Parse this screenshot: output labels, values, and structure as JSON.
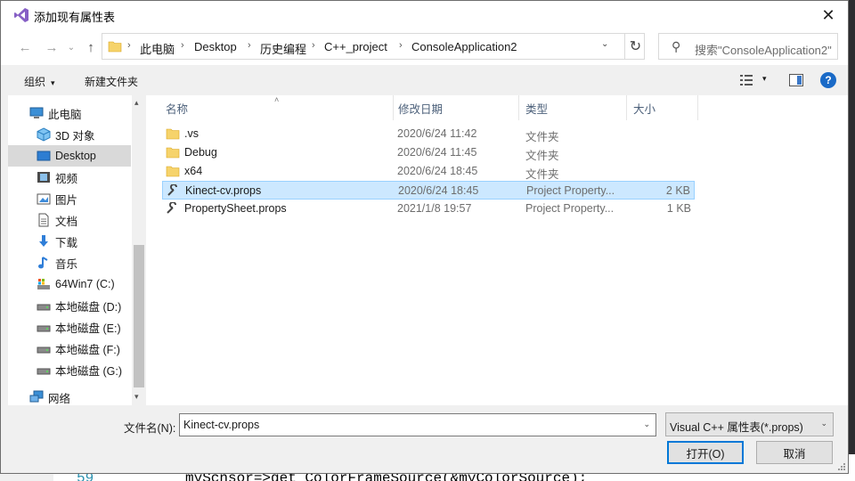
{
  "dialog": {
    "title": "添加现有属性表",
    "close_glyph": "✕"
  },
  "nav": {
    "back_glyph": "←",
    "forward_glyph": "→",
    "recent_glyph": "⌄",
    "up_glyph": "↑",
    "breadcrumb": [
      "此电脑",
      "Desktop",
      "历史编程",
      "C++_project",
      "ConsoleApplication2"
    ],
    "separator": "›",
    "dropdown_glyph": "⌄",
    "refresh_glyph": "↻",
    "search_placeholder": "搜索\"ConsoleApplication2\"",
    "search_glyph": "⚲"
  },
  "toolbar": {
    "organize": "组织",
    "caret": "▾",
    "new_folder": "新建文件夹",
    "help": "?"
  },
  "sidebar": {
    "scroll_up": "▴",
    "scroll_down": "▾",
    "items": [
      {
        "label": "此电脑",
        "icon": "computer-icon"
      },
      {
        "label": "3D 对象",
        "icon": "cube-3d-icon"
      },
      {
        "label": "Desktop",
        "icon": "desktop-icon"
      },
      {
        "label": "视频",
        "icon": "video-icon"
      },
      {
        "label": "图片",
        "icon": "pictures-icon"
      },
      {
        "label": "文档",
        "icon": "documents-icon"
      },
      {
        "label": "下载",
        "icon": "download-icon"
      },
      {
        "label": "音乐",
        "icon": "music-icon"
      },
      {
        "label": "64Win7  (C:)",
        "icon": "system-drive-icon"
      },
      {
        "label": "本地磁盘 (D:)",
        "icon": "drive-icon"
      },
      {
        "label": "本地磁盘 (E:)",
        "icon": "drive-icon"
      },
      {
        "label": "本地磁盘 (F:)",
        "icon": "drive-icon"
      },
      {
        "label": "本地磁盘 (G:)",
        "icon": "drive-icon"
      },
      {
        "label": "网络",
        "icon": "network-icon"
      }
    ]
  },
  "files": {
    "sort_caret": "˄",
    "columns": [
      "名称",
      "修改日期",
      "类型",
      "大小"
    ],
    "rows": [
      {
        "name": ".vs",
        "date": "2020/6/24 11:42",
        "type": "文件夹",
        "size": "",
        "icon": "folder-icon"
      },
      {
        "name": "Debug",
        "date": "2020/6/24 11:45",
        "type": "文件夹",
        "size": "",
        "icon": "folder-icon"
      },
      {
        "name": "x64",
        "date": "2020/6/24 18:45",
        "type": "文件夹",
        "size": "",
        "icon": "folder-icon"
      },
      {
        "name": "Kinect-cv.props",
        "date": "2020/6/24 18:45",
        "type": "Project Property...",
        "size": "2 KB",
        "icon": "wrench-icon",
        "selected": true
      },
      {
        "name": "PropertySheet.props",
        "date": "2021/1/8 19:57",
        "type": "Project Property...",
        "size": "1 KB",
        "icon": "wrench-icon"
      }
    ]
  },
  "bottom": {
    "filename_label": "文件名(N):",
    "filename_value": "Kinect-cv.props",
    "filter_value": "Visual C++ 属性表(*.props)",
    "dd_glyph": "⌄",
    "open_button": "打开(O)",
    "cancel_button": "取消"
  },
  "editor": {
    "line_number": "59",
    "code_line": "myScnsor=>get ColorFrameSource(&myColorSource);"
  },
  "colors": {
    "accent": "#0078d7",
    "selection": "#cce8ff",
    "selection_border": "#99d1ff",
    "folder": "#f6d36b",
    "vs_purple": "#865fc5"
  }
}
